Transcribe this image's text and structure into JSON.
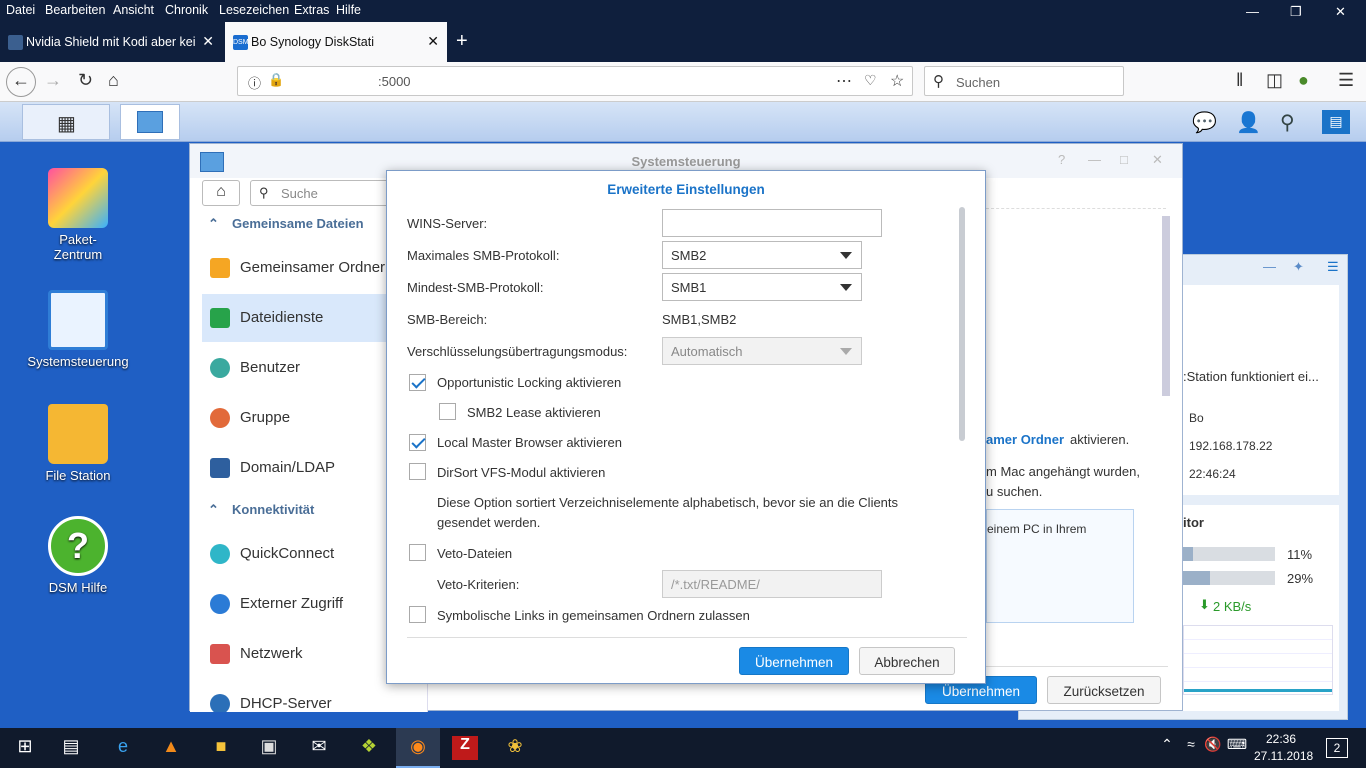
{
  "menubar": [
    "Datei",
    "Bearbeiten",
    "Ansicht",
    "Chronik",
    "Lesezeichen",
    "Extras",
    "Hilfe"
  ],
  "tabs": [
    {
      "label": "Nvidia Shield mit Kodi aber kei"
    },
    {
      "label": "Bo​           Synology DiskStati"
    }
  ],
  "tab2_favicon": "DSM",
  "url": ":5000",
  "search_placeholder": "Suchen",
  "desktop_icons": [
    {
      "label": "Paket-\nZentrum"
    },
    {
      "label": "Systemsteuerung"
    },
    {
      "label": "File Station"
    },
    {
      "label": "DSM Hilfe"
    }
  ],
  "cp": {
    "title": "Systemsteuerung",
    "search_placeholder": "Suche",
    "section1": "Gemeinsame Dateien",
    "section2": "Konnektivität",
    "items": [
      "Gemeinsamer Ordner",
      "Dateidienste",
      "Benutzer",
      "Gruppe",
      "Domain/LDAP",
      "QuickConnect",
      "Externer Zugriff",
      "Netzwerk",
      "DHCP-Server"
    ],
    "link_text": "amer Ordner",
    "link_suffix": " aktivieren.",
    "mac_line1": "m Mac angehängt wurden,",
    "mac_line2": "u suchen.",
    "box_text": "einem PC in Ihrem",
    "apply": "Übernehmen",
    "reset": "Zurücksetzen"
  },
  "widget": {
    "status": ":Station funktioniert ei...",
    "name": "Bo",
    "ip": "192.168.178.22",
    "time": "22:46:24",
    "monitor": "itor",
    "cpu": "11%",
    "ram": "29%",
    "net": "2 KB/s",
    "cpu_value": 0.11,
    "ram_value": 0.29
  },
  "modal": {
    "title": "Erweiterte Einstellungen",
    "wins_label": "WINS-Server:",
    "wins_value": "",
    "max_label": "Maximales SMB-Protokoll:",
    "max_value": "SMB2",
    "min_label": "Mindest-SMB-Protokoll:",
    "min_value": "SMB1",
    "range_label": "SMB-Bereich:",
    "range_value": "SMB1,SMB2",
    "enc_label": "Verschlüsselungsübertragungsmodus:",
    "enc_value": "Automatisch",
    "opp_lock": "Opportunistic Locking aktivieren",
    "smb2_lease": "SMB2 Lease aktivieren",
    "lmb": "Local Master Browser aktivieren",
    "dirsort": "DirSort VFS-Modul aktivieren",
    "dirsort_desc1": "Diese Option sortiert Verzeichniselemente alphabetisch, bevor sie an die Clients",
    "dirsort_desc2": "gesendet werden.",
    "veto": "Veto-Dateien",
    "veto_crit_label": "Veto-Kriterien:",
    "veto_crit_placeholder": "/*.txt/README/",
    "symlinks": "Symbolische Links in gemeinsamen Ordnern zulassen",
    "apply": "Übernehmen",
    "cancel": "Abbrechen"
  },
  "tray": {
    "time": "22:36",
    "date": "27.11.2018",
    "notif": "2"
  }
}
